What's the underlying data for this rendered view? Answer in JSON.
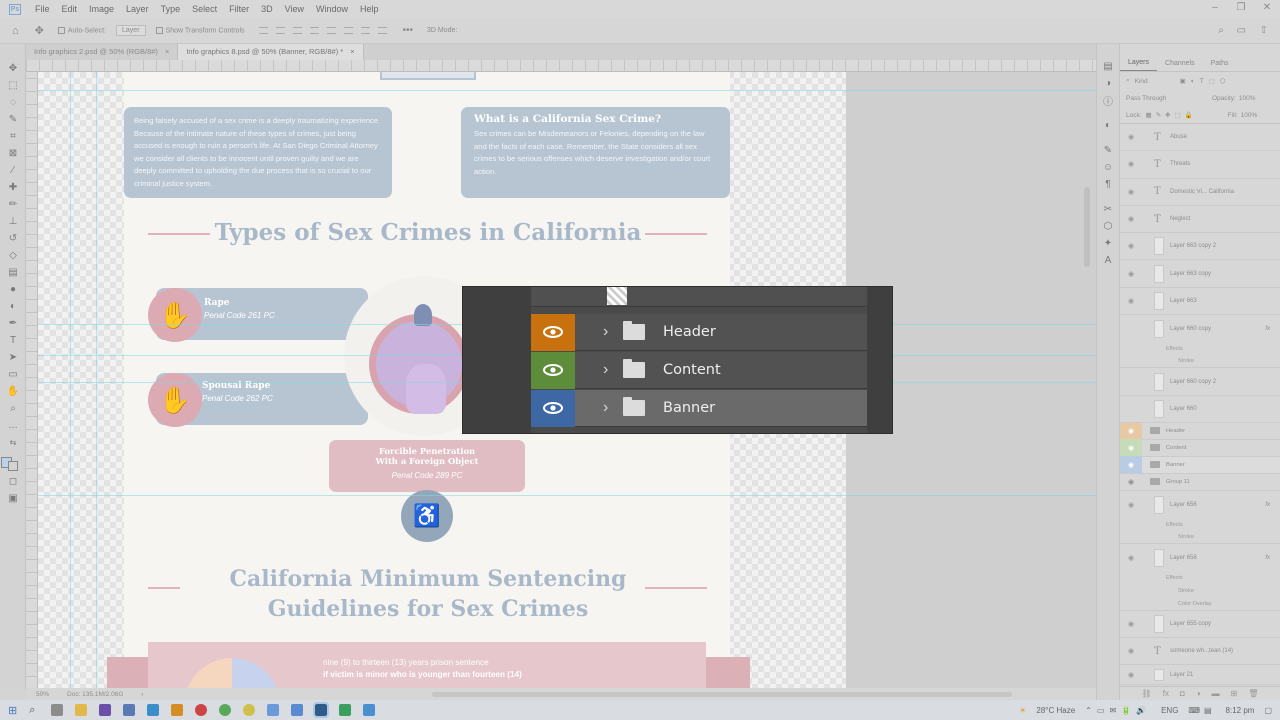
{
  "menu": [
    "File",
    "Edit",
    "Image",
    "Layer",
    "Type",
    "Select",
    "Filter",
    "3D",
    "View",
    "Window",
    "Help"
  ],
  "window_controls": [
    "–",
    "❐",
    "✕"
  ],
  "options": {
    "auto_select": "Auto-Select:",
    "auto_select_target": "Layer",
    "show_transform": "Show Transform Controls",
    "mode_3d": "3D Mode:"
  },
  "doc_tabs": [
    {
      "label": "Info graphics 2.psd @ 50% (RGB/8#)",
      "close": "×"
    },
    {
      "label": "Info graphics 8.psd @ 50% (Banner, RGB/8#) *",
      "close": "×"
    }
  ],
  "status": {
    "zoom": "50%",
    "doc": "Doc: 135.1M/2.06G"
  },
  "artboard": {
    "intro_text": "Being falsely accused of a sex crime is a deeply traumatizing experience. Because of the intimate nature of these types of crimes, just being accused is enough to ruin a person's life. At San Diego Criminal Attorney we consider all clients to be innocent until proven guilty and we are deeply committed to upholding the due process that is so crucial to our criminal justice system.",
    "what_title": "What is a California Sex Crime?",
    "what_text": "Sex crimes can be Misdemeanors or Felonies, depending on the law and the facts of each case. Remember, the State considers all sex crimes to be serious offenses which deserve investigation and/or court action.",
    "types_title": "Types of Sex Crimes in California",
    "crime1_title": "Rape",
    "crime1_code": "Penal Code 261 PC",
    "crime2_title": "Spousal Rape",
    "crime2_code": "Penal Code 262 PC",
    "crime3_title_1": "Forcible Penetration",
    "crime3_title_2": "With a Foreign Object",
    "crime3_code": "Penal Code 289 PC",
    "sentencing_title_1": "California Minimum Sentencing",
    "sentencing_title_2": "Guidelines for Sex Crimes",
    "sentence_line1": "nine (9) to thirteen (13) years prison sentence",
    "sentence_line2": "if victim is minor who is younger than fourteen (14)"
  },
  "layers_panel": {
    "tabs": [
      "Layers",
      "Channels",
      "Paths"
    ],
    "kind": "Kind",
    "blend_mode": "Pass Through",
    "opacity_label": "Opacity:",
    "opacity": "100%",
    "lock_label": "Lock:",
    "fill_label": "Fill:",
    "fill": "100%",
    "layers": [
      {
        "name": "Abuse",
        "type": "text"
      },
      {
        "name": "Threats",
        "type": "text"
      },
      {
        "name": "Domestic Vi... California",
        "type": "text"
      },
      {
        "name": "Neglect",
        "type": "text"
      },
      {
        "name": "Layer 663 copy 2",
        "type": "pixel"
      },
      {
        "name": "Layer 663 copy",
        "type": "pixel"
      },
      {
        "name": "Layer 663",
        "type": "pixel"
      },
      {
        "name": "Layer 660 copy",
        "type": "pixel",
        "fx": "fx"
      },
      {
        "name": "Layer 660 copy 2",
        "type": "pixel"
      },
      {
        "name": "Layer 660",
        "type": "pixel"
      }
    ],
    "effects_label": "Effects",
    "stroke_label": "Stroke",
    "color_overlay_label": "Color Overlay",
    "groups": [
      {
        "name": "Header",
        "color": "#e7b98a"
      },
      {
        "name": "Content",
        "color": "#b8d3a9"
      },
      {
        "name": "Banner",
        "color": "#a9bfdc"
      },
      {
        "name": "Group 11",
        "color": ""
      }
    ],
    "layers_bottom": [
      {
        "name": "Layer 656",
        "type": "pixel",
        "fx": "fx"
      },
      {
        "name": "Layer 658",
        "type": "pixel",
        "fx": "fx"
      },
      {
        "name": "Layer 655 copy",
        "type": "pixel"
      },
      {
        "name": "someone wh...tean (14)",
        "type": "text"
      },
      {
        "name": "Layer 21",
        "type": "pixel"
      }
    ]
  },
  "zoom_overlay": {
    "rows": [
      {
        "label": "Header",
        "eye_color": "#c8720f"
      },
      {
        "label": "Content",
        "eye_color": "#5d8c3a"
      },
      {
        "label": "Banner",
        "eye_color": "#3d68a3"
      }
    ]
  },
  "taskbar": {
    "weather": "28°C  Haze",
    "lang": "ENG",
    "time": "8:12 pm"
  }
}
